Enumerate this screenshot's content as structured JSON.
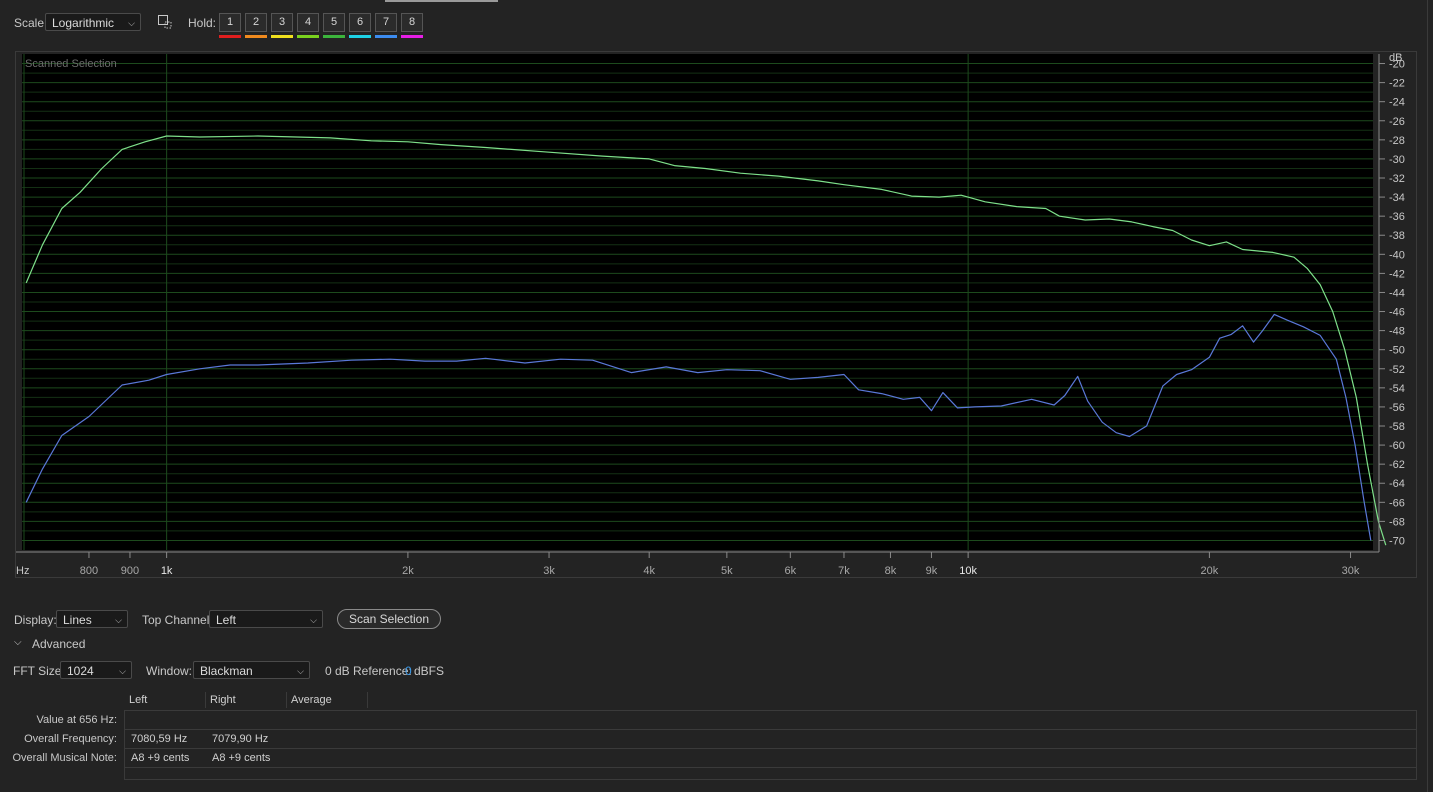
{
  "toolbar": {
    "scale_label": "Scale:",
    "scale_value": "Logarithmic",
    "hold_label": "Hold:",
    "hold_buttons": [
      {
        "label": "1",
        "color": "#e01e1e"
      },
      {
        "label": "2",
        "color": "#f08a1e"
      },
      {
        "label": "3",
        "color": "#f0e01e"
      },
      {
        "label": "4",
        "color": "#7ad21e"
      },
      {
        "label": "5",
        "color": "#3cb43c"
      },
      {
        "label": "6",
        "color": "#1ed2e6"
      },
      {
        "label": "7",
        "color": "#3c8cf0"
      },
      {
        "label": "8",
        "color": "#e61ee6"
      }
    ]
  },
  "chart": {
    "overlay_label": "Scanned Selection",
    "y_unit": "dB",
    "x_unit": "Hz"
  },
  "chart_data": {
    "type": "line",
    "x_scale": "log",
    "xlim": [
      660,
      32000
    ],
    "ylim": [
      -71,
      -19
    ],
    "grid": true,
    "x_ticks": [
      800,
      900,
      1000,
      2000,
      3000,
      4000,
      5000,
      6000,
      7000,
      8000,
      9000,
      10000,
      20000,
      30000
    ],
    "x_tick_labels": [
      "800",
      "900",
      "1k",
      "2k",
      "3k",
      "4k",
      "5k",
      "6k",
      "7k",
      "8k",
      "9k",
      "10k",
      "20k",
      "30k"
    ],
    "y_ticks": [
      -20,
      -22,
      -24,
      -26,
      -28,
      -30,
      -32,
      -34,
      -36,
      -38,
      -40,
      -42,
      -44,
      -46,
      -48,
      -50,
      -52,
      -54,
      -56,
      -58,
      -60,
      -62,
      -64,
      -66,
      -68,
      -70
    ],
    "y_tick_labels": [
      "-20",
      "-22",
      "-24",
      "-26",
      "-28",
      "-30",
      "-32",
      "-34",
      "-36",
      "-38",
      "-40",
      "-42",
      "-44",
      "-46",
      "-48",
      "-50",
      "-52",
      "-54",
      "-56",
      "-58",
      "-60",
      "-62",
      "-64",
      "-66",
      "-68",
      "-70"
    ],
    "series": [
      {
        "color": "#7ee08a",
        "points": [
          [
            668,
            -43
          ],
          [
            700,
            -39
          ],
          [
            740,
            -35.2
          ],
          [
            780,
            -33.5
          ],
          [
            830,
            -31
          ],
          [
            880,
            -29
          ],
          [
            940,
            -28.2
          ],
          [
            1000,
            -27.6
          ],
          [
            1100,
            -27.7
          ],
          [
            1300,
            -27.6
          ],
          [
            1600,
            -27.8
          ],
          [
            1800,
            -28.1
          ],
          [
            2000,
            -28.2
          ],
          [
            2200,
            -28.5
          ],
          [
            2500,
            -28.8
          ],
          [
            3000,
            -29.3
          ],
          [
            3500,
            -29.7
          ],
          [
            4000,
            -30
          ],
          [
            4300,
            -30.7
          ],
          [
            4700,
            -31
          ],
          [
            5200,
            -31.5
          ],
          [
            5800,
            -31.8
          ],
          [
            6500,
            -32.3
          ],
          [
            7000,
            -32.7
          ],
          [
            7800,
            -33.2
          ],
          [
            8500,
            -33.9
          ],
          [
            9200,
            -34
          ],
          [
            9800,
            -33.8
          ],
          [
            10500,
            -34.5
          ],
          [
            11500,
            -35
          ],
          [
            12500,
            -35.2
          ],
          [
            13000,
            -36
          ],
          [
            14000,
            -36.4
          ],
          [
            15000,
            -36.3
          ],
          [
            16000,
            -36.6
          ],
          [
            17000,
            -37.1
          ],
          [
            18000,
            -37.5
          ],
          [
            19000,
            -38.5
          ],
          [
            20000,
            -39.1
          ],
          [
            21000,
            -38.7
          ],
          [
            22000,
            -39.5
          ],
          [
            24000,
            -39.8
          ],
          [
            25500,
            -40.3
          ],
          [
            26500,
            -41.5
          ],
          [
            27500,
            -43.2
          ],
          [
            28500,
            -46
          ],
          [
            29500,
            -50
          ],
          [
            30500,
            -55
          ],
          [
            31500,
            -62
          ],
          [
            32500,
            -68
          ],
          [
            33200,
            -70.5
          ]
        ]
      },
      {
        "color": "#5a78d8",
        "points": [
          [
            668,
            -66
          ],
          [
            700,
            -62.5
          ],
          [
            740,
            -59
          ],
          [
            800,
            -57
          ],
          [
            880,
            -53.7
          ],
          [
            950,
            -53.2
          ],
          [
            1000,
            -52.6
          ],
          [
            1100,
            -52
          ],
          [
            1200,
            -51.6
          ],
          [
            1300,
            -51.6
          ],
          [
            1500,
            -51.4
          ],
          [
            1700,
            -51.1
          ],
          [
            1900,
            -51
          ],
          [
            2100,
            -51.2
          ],
          [
            2300,
            -51.2
          ],
          [
            2500,
            -50.9
          ],
          [
            2800,
            -51.4
          ],
          [
            3100,
            -51
          ],
          [
            3400,
            -51.1
          ],
          [
            3800,
            -52.4
          ],
          [
            4200,
            -51.8
          ],
          [
            4600,
            -52.4
          ],
          [
            5000,
            -52.1
          ],
          [
            5500,
            -52.2
          ],
          [
            6000,
            -53.1
          ],
          [
            6500,
            -52.9
          ],
          [
            7000,
            -52.6
          ],
          [
            7300,
            -54.2
          ],
          [
            7800,
            -54.6
          ],
          [
            8300,
            -55.2
          ],
          [
            8700,
            -55
          ],
          [
            9000,
            -56.4
          ],
          [
            9300,
            -54.5
          ],
          [
            9700,
            -56.1
          ],
          [
            10200,
            -56
          ],
          [
            11000,
            -55.9
          ],
          [
            12000,
            -55.2
          ],
          [
            12800,
            -55.8
          ],
          [
            13200,
            -54.8
          ],
          [
            13700,
            -52.8
          ],
          [
            14100,
            -55.4
          ],
          [
            14700,
            -57.6
          ],
          [
            15300,
            -58.7
          ],
          [
            15900,
            -59.1
          ],
          [
            16700,
            -58
          ],
          [
            17500,
            -53.8
          ],
          [
            18200,
            -52.6
          ],
          [
            19000,
            -52.1
          ],
          [
            20000,
            -50.8
          ],
          [
            20600,
            -48.8
          ],
          [
            21300,
            -48.4
          ],
          [
            22000,
            -47.5
          ],
          [
            22700,
            -49.2
          ],
          [
            23300,
            -48
          ],
          [
            24100,
            -46.3
          ],
          [
            25000,
            -46.9
          ],
          [
            26200,
            -47.6
          ],
          [
            27500,
            -48.5
          ],
          [
            28800,
            -51
          ],
          [
            29600,
            -55
          ],
          [
            30400,
            -60
          ],
          [
            31200,
            -66
          ],
          [
            31800,
            -70
          ]
        ]
      }
    ]
  },
  "controls": {
    "display_label": "Display:",
    "display_value": "Lines",
    "top_channel_label": "Top Channel:",
    "top_channel_value": "Left",
    "scan_button": "Scan Selection",
    "advanced_label": "Advanced",
    "fft_label": "FFT Size:",
    "fft_value": "1024",
    "window_label": "Window:",
    "window_value": "Blackman",
    "db_ref_label": "0 dB Reference:",
    "db_ref_value": "0",
    "db_ref_unit": "dBFS"
  },
  "table": {
    "headers": [
      "Left",
      "Right",
      "Average"
    ],
    "rows": [
      {
        "label": "Value at 656 Hz:",
        "left": "",
        "right": ""
      },
      {
        "label": "Overall Frequency:",
        "left": "7080,59 Hz",
        "right": "7079,90 Hz"
      },
      {
        "label": "Overall Musical Note:",
        "left": "A8 +9 cents",
        "right": "A8 +9 cents"
      }
    ]
  }
}
